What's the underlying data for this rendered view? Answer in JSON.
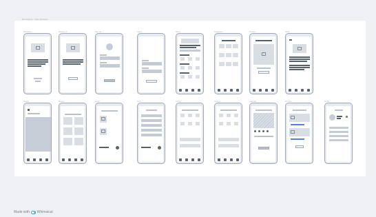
{
  "canvas": {
    "title": "Wireframe · App Screens"
  },
  "screens_row1": [
    {
      "label": "Welcome 1"
    },
    {
      "label": "Welcome 2"
    },
    {
      "label": "Sign Up"
    },
    {
      "label": "Log In"
    },
    {
      "label": "Home"
    },
    {
      "label": "Categories"
    },
    {
      "label": "Product"
    },
    {
      "label": "Article"
    }
  ],
  "screens_row2": [
    {
      "label": "Search"
    },
    {
      "label": "Browse"
    },
    {
      "label": "Detail"
    },
    {
      "label": "Form"
    },
    {
      "label": "Listing"
    },
    {
      "label": "Listing 2"
    },
    {
      "label": "Calendar"
    },
    {
      "label": "Reviews"
    },
    {
      "label": "Profile"
    }
  ],
  "footer": {
    "prefix": "Made with",
    "brand": "Whimsical"
  }
}
